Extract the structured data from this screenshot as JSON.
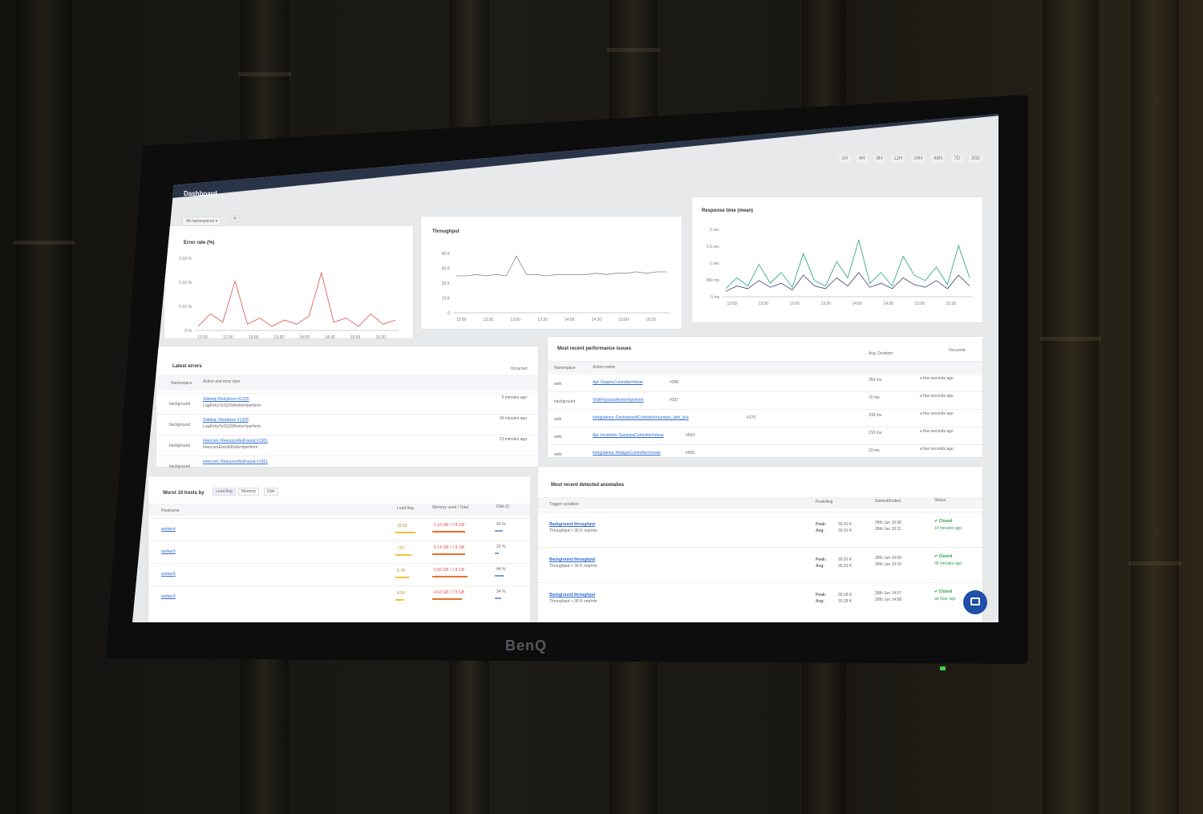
{
  "app": {
    "title": "Dashboard",
    "brand": "BenQ"
  },
  "time_ranges": [
    "1H",
    "4H",
    "8H",
    "12H",
    "24H",
    "48H",
    "7D",
    "30D"
  ],
  "filters": {
    "namespace": "All namespaces ▾",
    "edit_icon": "pencil-icon"
  },
  "charts": {
    "error_rate": {
      "title": "Error rate (%)",
      "y_ticks": [
        "0.03 %",
        "0.02 %",
        "0.01 %",
        "0 %"
      ],
      "x_ticks": [
        "12:00",
        "12:30",
        "13:00",
        "13:30",
        "14:00",
        "14:30",
        "15:00",
        "15:30"
      ]
    },
    "throughput": {
      "title": "Throughput",
      "y_ticks": [
        "40 K",
        "30 K",
        "20 K",
        "10 K",
        "0"
      ],
      "x_ticks": [
        "12:00",
        "12:30",
        "13:00",
        "13:30",
        "14:00",
        "14:30",
        "15:00",
        "15:30"
      ]
    },
    "response_time": {
      "title": "Response time (mean)",
      "y_ticks": [
        "2 sec",
        "1.5 sec",
        "1 sec",
        "500 ms",
        "0 ms"
      ],
      "x_ticks": [
        "12:00",
        "12:30",
        "13:00",
        "13:30",
        "14:00",
        "14:30",
        "15:00",
        "15:30"
      ]
    }
  },
  "chart_data": [
    {
      "type": "line",
      "title": "Error rate (%)",
      "x": [
        "12:00",
        "12:30",
        "13:00",
        "13:30",
        "14:00",
        "14:30",
        "15:00",
        "15:30"
      ],
      "series": [
        {
          "values": [
            0.002,
            0.008,
            0.004,
            0.024,
            0.003,
            0.006,
            0.002,
            0.005,
            0.003,
            0.007,
            0.028,
            0.004,
            0.006,
            0.002,
            0.008,
            0.003,
            0.005
          ]
        }
      ],
      "ylim": [
        0,
        0.035
      ]
    },
    {
      "type": "line",
      "title": "Throughput",
      "x": [
        "12:00",
        "12:30",
        "13:00",
        "13:30",
        "14:00",
        "14:30",
        "15:00",
        "15:30"
      ],
      "series": [
        {
          "values": [
            28,
            28,
            29,
            28,
            29,
            28,
            43,
            29,
            29,
            28,
            29,
            29,
            29,
            29,
            30,
            29,
            30,
            30,
            31,
            30,
            31,
            31
          ]
        }
      ],
      "ylim": [
        0,
        45
      ]
    },
    {
      "type": "line",
      "title": "Response time (mean)",
      "x": [
        "12:00",
        "12:30",
        "13:00",
        "13:30",
        "14:00",
        "14:30",
        "15:00",
        "15:30"
      ],
      "series": [
        {
          "values": [
            300,
            700,
            400,
            1200,
            500,
            900,
            350,
            1600,
            600,
            400,
            1300,
            700,
            2100,
            500,
            900,
            400,
            1500,
            800,
            600,
            1100,
            450,
            1900,
            700
          ]
        },
        {
          "values": [
            200,
            400,
            300,
            600,
            350,
            500,
            250,
            800,
            400,
            300,
            700,
            400,
            900,
            350,
            500,
            300,
            700,
            450,
            350,
            600,
            300,
            800,
            400
          ]
        }
      ],
      "ylim": [
        0,
        2500
      ]
    }
  ],
  "latest_errors": {
    "title": "Latest errors",
    "cols": [
      "Namespace",
      "Action and error type",
      "Occurred"
    ],
    "rows": [
      {
        "ns": "background",
        "error": "Sidekiq::RetryError #1325",
        "action": "LogEntryToSQSWorker#perform",
        "when": "5 minutes ago"
      },
      {
        "ns": "background",
        "error": "Sidekiq::Shutdown #1329",
        "action": "LogEntryToSQSWorker#perform",
        "when": "36 minutes ago"
      },
      {
        "ns": "background",
        "error": "Intercom::ResourceNotFound #1301",
        "action": "IntercomEventWorker#perform",
        "when": "23 minutes ago"
      },
      {
        "ns": "background",
        "error": "Intercom::ResourceNotFound #1361",
        "action": "",
        "when": ""
      }
    ]
  },
  "perf_issues": {
    "title": "Most recent performance issues",
    "cols": [
      "Namespace",
      "Action name",
      "Avg. Duration",
      "Occurred"
    ],
    "rows": [
      {
        "ns": "web",
        "action": "Api::GraphsController#show",
        "num": "#298",
        "dur": "259 ms",
        "when": "a few seconds ago"
      },
      {
        "ns": "background",
        "action": "VisitProcessWorker#perform",
        "num": "#337",
        "dur": "70 ms",
        "when": "a few seconds ago"
      },
      {
        "ns": "web",
        "action": "Integrations::GeckoboardController#number_with_line",
        "num": "#176",
        "dur": "218 ms",
        "when": "a few seconds ago"
      },
      {
        "ns": "web",
        "action": "Api::Incidents::SamplesController#show",
        "num": "#503",
        "dur": "210 ms",
        "when": "a few seconds ago"
      },
      {
        "ns": "web",
        "action": "Integrations::MailgunController#create",
        "num": "#600",
        "dur": "23 ms",
        "when": "a few seconds ago"
      }
    ]
  },
  "hosts": {
    "title": "Worst 10 hosts by",
    "tabs": [
      "Load Avg",
      "Memory",
      "Disk"
    ],
    "cols": [
      "Hostname",
      "Load Avg",
      "Memory used / Total",
      "Disk (/)"
    ],
    "rows": [
      {
        "host": "worker4",
        "load": "10.63",
        "mem": "5.16 GB / 7.8 GB",
        "disk": "42 %",
        "load_frac": 0.9,
        "mem_frac": 0.66,
        "disk_frac": 0.42
      },
      {
        "host": "worker5",
        "load": "7.57",
        "mem": "5.14 GB / 7.8 GB",
        "disk": "22 %",
        "load_frac": 0.7,
        "mem_frac": 0.66,
        "disk_frac": 0.22
      },
      {
        "host": "worker6",
        "load": "6.78",
        "mem": "5.56 GB / 7.8 GB",
        "disk": "44 %",
        "load_frac": 0.6,
        "mem_frac": 0.71,
        "disk_frac": 0.44
      },
      {
        "host": "worker3",
        "load": "4.59",
        "mem": "4.63 GB / 7.8 GB",
        "disk": "34 %",
        "load_frac": 0.4,
        "mem_frac": 0.59,
        "disk_frac": 0.34
      }
    ]
  },
  "anomalies": {
    "title": "Most recent detected anomalies",
    "cols": [
      "Trigger condition",
      "Peak/Avg",
      "Started/Ended",
      "Status"
    ],
    "rows": [
      {
        "trigger": "Background throughput",
        "cond": "Throughput > 30 K req/min",
        "peak": "30,01 K",
        "avg": "30,01 K",
        "start": "28th Jun 15:30",
        "end": "28th Jun 15:31",
        "status": "✔ Closed",
        "ago": "14 minutes ago"
      },
      {
        "trigger": "Background throughput",
        "cond": "Throughput > 30 K req/min",
        "peak": "30,91 K",
        "avg": "30,91 K",
        "start": "28th Jun 15:09",
        "end": "28th Jun 15:10",
        "status": "✔ Closed",
        "ago": "35 minutes ago"
      },
      {
        "trigger": "Background throughput",
        "cond": "Throughput > 30 K req/min",
        "peak": "30,28 K",
        "avg": "30,28 K",
        "start": "28th Jun 14:57",
        "end": "28th Jun 14:58",
        "status": "✔ Closed",
        "ago": "an hour ago"
      }
    ],
    "peak_label": "Peak:",
    "avg_label": "Avg:"
  },
  "colors": {
    "error": "#d9534f",
    "throughput": "#888888",
    "resp1": "#1fa37a",
    "resp2": "#3b3b6e",
    "accent": "#2d6bcf",
    "ok": "#27a348"
  }
}
